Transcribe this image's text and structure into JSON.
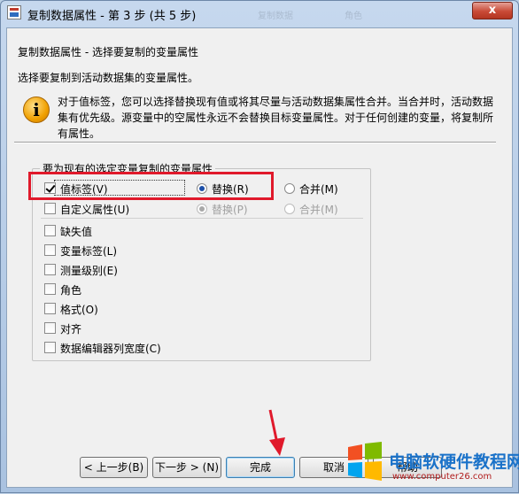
{
  "window": {
    "title": "复制数据属性 - 第 3 步 (共 5 步)",
    "close_label": "x",
    "ghost_tabs": [
      "复制数据",
      "角色"
    ]
  },
  "step": {
    "title": "复制数据属性 - 选择要复制的变量属性",
    "subtitle": "选择要复制到活动数据集的变量属性。",
    "info": "对于值标签，您可以选择替换现有值或将其尽量与活动数据集属性合并。当合并时，活动数据集有优先级。源变量中的空属性永远不会替换目标变量属性。对于任何创建的变量，将复制所有属性。"
  },
  "group": {
    "legend": "要为现有的选定变量复制的变量属性",
    "value_labels": {
      "label": "值标签(V)",
      "checked": true,
      "replace": "替换(R)",
      "merge": "合并(M)",
      "selected": "replace"
    },
    "custom_attributes": {
      "label": "自定义属性(U)",
      "checked": false,
      "replace": "替换(P)",
      "merge": "合并(M)",
      "selected": "replace",
      "disabled": true
    },
    "items": [
      {
        "label": "缺失值",
        "checked": false
      },
      {
        "label": "变量标签(L)",
        "checked": false
      },
      {
        "label": "测量级别(E)",
        "checked": false
      },
      {
        "label": "角色",
        "checked": false
      },
      {
        "label": "格式(O)",
        "checked": false
      },
      {
        "label": "对齐",
        "checked": false
      },
      {
        "label": "数据编辑器列宽度(C)",
        "checked": false
      }
    ]
  },
  "buttons": {
    "back": "< 上一步(B)",
    "next": "下一步 > (N)",
    "finish": "完成",
    "cancel": "取消",
    "help": "帮助"
  },
  "watermark": {
    "text": "电脑软硬件教程网",
    "url": "www.computer26.com"
  },
  "colors": {
    "highlight": "#e0192b",
    "arrow": "#e0192b",
    "close_button": "#c94a36",
    "watermark_blue": "#1a72c9"
  }
}
